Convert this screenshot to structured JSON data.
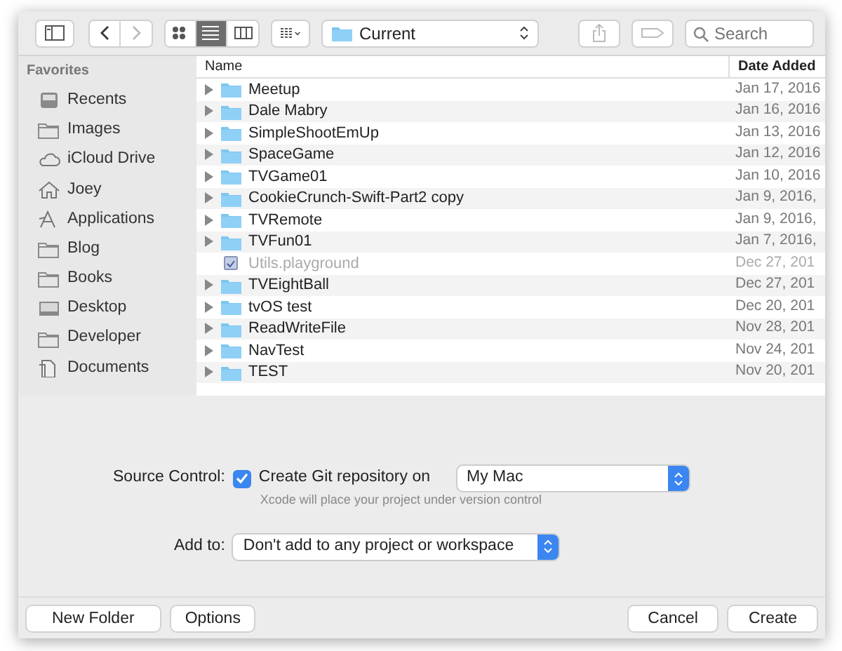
{
  "toolbar": {
    "view_modes": [
      {
        "selected": false
      },
      {
        "selected": true
      },
      {
        "selected": false
      }
    ],
    "path": "Current",
    "search": {
      "placeholder": "Search"
    }
  },
  "sidebar": {
    "heading": "Favorites",
    "items": [
      {
        "label": "Recents",
        "kind": "recents"
      },
      {
        "label": "Images",
        "kind": "folder"
      },
      {
        "label": "iCloud Drive",
        "kind": "cloud"
      },
      {
        "label": "Joey",
        "kind": "home"
      },
      {
        "label": "Applications",
        "kind": "apps"
      },
      {
        "label": "Blog",
        "kind": "folder"
      },
      {
        "label": "Books",
        "kind": "folder"
      },
      {
        "label": "Desktop",
        "kind": "desktop"
      },
      {
        "label": "Developer",
        "kind": "folder"
      },
      {
        "label": "Documents",
        "kind": "documents"
      }
    ]
  },
  "table": {
    "columns": [
      "Name",
      "Date Added"
    ],
    "rows": [
      {
        "name": "Meetup",
        "date": "Jan 17, 2016",
        "kind": "folder",
        "disabled": false
      },
      {
        "name": "Dale Mabry",
        "date": "Jan 16, 2016",
        "kind": "folder",
        "disabled": false
      },
      {
        "name": "SimpleShootEmUp",
        "date": "Jan 13, 2016",
        "kind": "folder",
        "disabled": false
      },
      {
        "name": "SpaceGame",
        "date": "Jan 12, 2016",
        "kind": "folder",
        "disabled": false
      },
      {
        "name": "TVGame01",
        "date": "Jan 10, 2016",
        "kind": "folder",
        "disabled": false
      },
      {
        "name": "CookieCrunch-Swift-Part2 copy",
        "date": "Jan 9, 2016,",
        "kind": "folder",
        "disabled": false
      },
      {
        "name": "TVRemote",
        "date": "Jan 9, 2016,",
        "kind": "folder",
        "disabled": false
      },
      {
        "name": "TVFun01",
        "date": "Jan 7, 2016,",
        "kind": "folder",
        "disabled": false
      },
      {
        "name": "Utils.playground",
        "date": "Dec 27, 201",
        "kind": "file",
        "disabled": true
      },
      {
        "name": "TVEightBall",
        "date": "Dec 27, 201",
        "kind": "folder",
        "disabled": false
      },
      {
        "name": "tvOS test",
        "date": "Dec 20, 201",
        "kind": "folder",
        "disabled": false
      },
      {
        "name": "ReadWriteFile",
        "date": "Nov 28, 201",
        "kind": "folder",
        "disabled": false
      },
      {
        "name": "NavTest",
        "date": "Nov 24, 201",
        "kind": "folder",
        "disabled": false
      },
      {
        "name": "TEST",
        "date": "Nov 20, 201",
        "kind": "folder",
        "disabled": false
      }
    ]
  },
  "source_control": {
    "label": "Source Control:",
    "checkbox": {
      "label": "Create Git repository on",
      "checked": true
    },
    "location": "My Mac",
    "hint": "Xcode will place your project under version control"
  },
  "add_to": {
    "label": "Add to:",
    "value": "Don't add to any project or workspace"
  },
  "buttons": {
    "left": [
      "New Folder",
      "Options"
    ],
    "right": [
      "Cancel",
      "Create"
    ]
  }
}
